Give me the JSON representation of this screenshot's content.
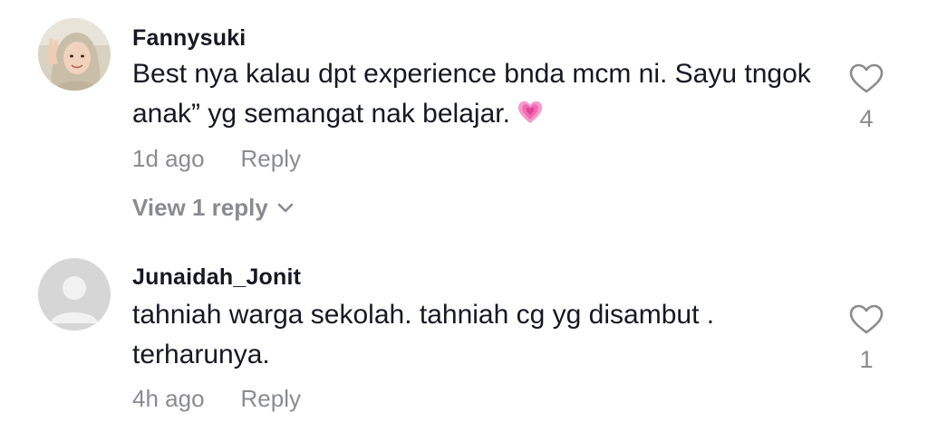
{
  "comments": [
    {
      "username": "Fannysuki",
      "text": "Best nya kalau dpt experience bnda mcm ni. Sayu tngok anak” yg semangat nak belajar.",
      "emoji": "growing-heart-emoji",
      "time": "1d ago",
      "reply_label": "Reply",
      "like_count": "4",
      "view_replies_label": "View 1 reply",
      "avatar": "profile-photo"
    },
    {
      "username": "Junaidah_Jonit",
      "text": "tahniah warga sekolah. tahniah cg yg disambut . terharunya.",
      "time": "4h ago",
      "reply_label": "Reply",
      "like_count": "1",
      "avatar": "default-avatar"
    }
  ],
  "colors": {
    "text_primary": "#161823",
    "text_secondary": "#8a8b91",
    "heart_outline": "#8a8b91",
    "default_avatar_bg": "#d6d6d6",
    "default_avatar_fg": "#f2f2f2",
    "emoji_pink": "#f06ab0"
  }
}
